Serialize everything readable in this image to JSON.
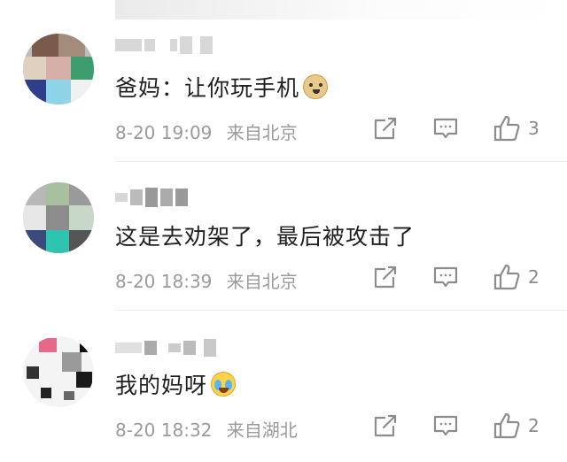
{
  "comments": [
    {
      "text": "爸妈：让你玩手机",
      "emoji": "doge-emoji",
      "date": "8-20",
      "time": "19:09",
      "location": "来自北京",
      "likes": "3"
    },
    {
      "text": "这是去劝架了，最后被攻击了",
      "emoji": "",
      "date": "8-20",
      "time": "18:39",
      "location": "来自北京",
      "likes": "2"
    },
    {
      "text": "我的妈呀",
      "emoji": "laugh-cry-emoji",
      "date": "8-20",
      "time": "18:32",
      "location": "来自湖北",
      "likes": "2"
    }
  ],
  "icons": {
    "share": "share-icon",
    "reply": "comment-icon",
    "like": "thumbs-up-icon"
  },
  "colors": {
    "text": "#1f1f1f",
    "meta": "#9a9a9a",
    "icon": "#8c8c8c"
  }
}
